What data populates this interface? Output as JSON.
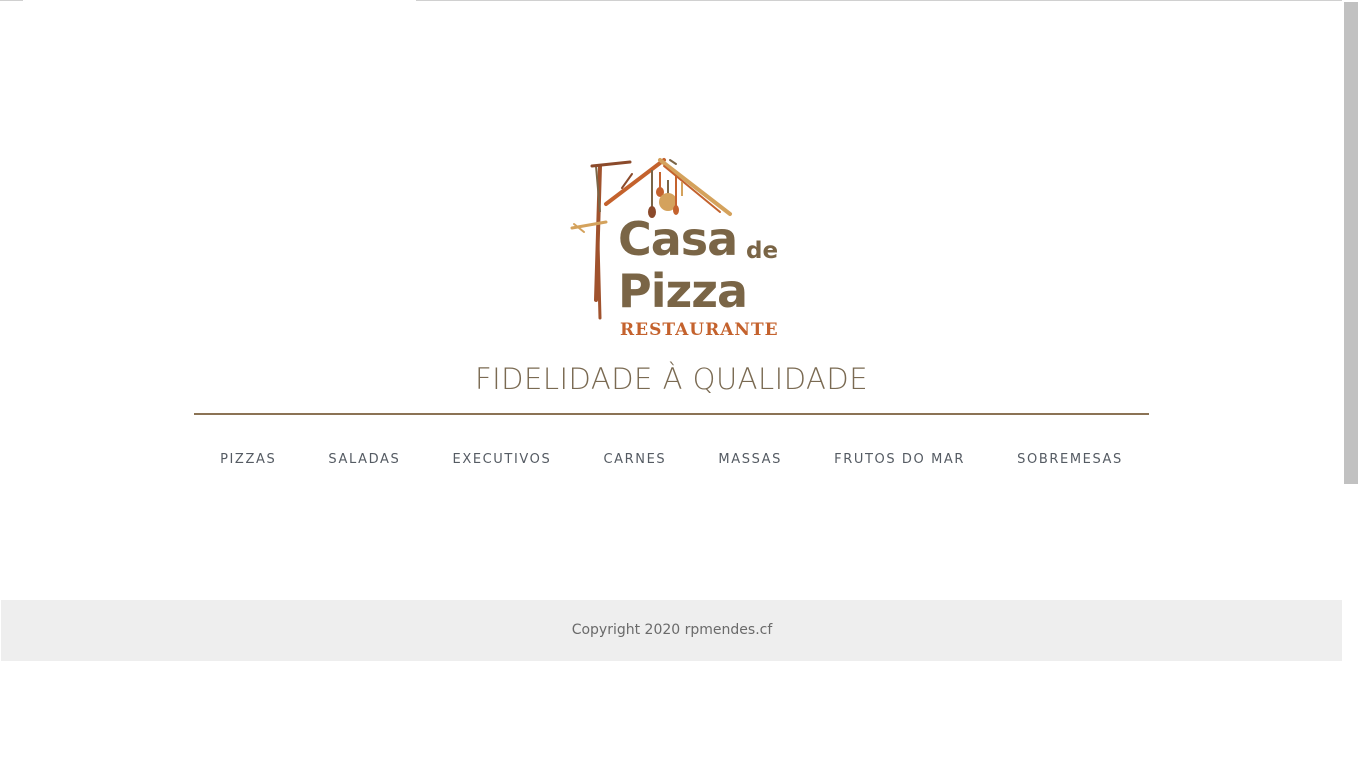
{
  "logo": {
    "line1": "Casa",
    "line1_small": "de",
    "line2": "Pizza",
    "line3": "RESTAURANTE",
    "colors": {
      "brown": "#7a6546",
      "orange": "#c4622d",
      "tan": "#d4a25c"
    }
  },
  "tagline": "FIDELIDADE À QUALIDADE",
  "nav": {
    "items": [
      {
        "label": "PIZZAS"
      },
      {
        "label": "SALADAS"
      },
      {
        "label": "EXECUTIVOS"
      },
      {
        "label": "CARNES"
      },
      {
        "label": "MASSAS"
      },
      {
        "label": "FRUTOS DO MAR"
      },
      {
        "label": "SOBREMESAS"
      }
    ]
  },
  "footer": {
    "copyright": "Copyright 2020 rpmendes.cf"
  },
  "colors": {
    "rule": "#8b7355",
    "nav_text": "#555b63",
    "footer_bg": "#eeeeee"
  }
}
